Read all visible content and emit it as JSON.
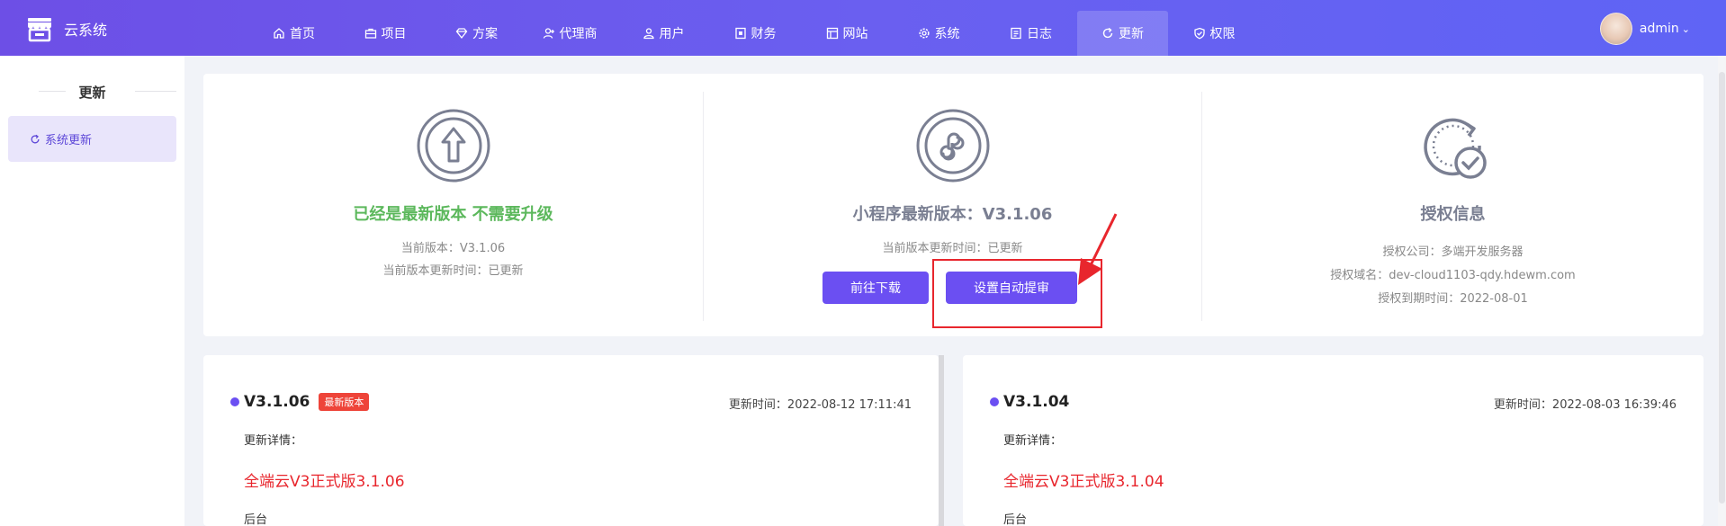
{
  "brand": {
    "name": "云系统"
  },
  "nav": [
    {
      "label": "首页",
      "icon": "home-icon"
    },
    {
      "label": "项目",
      "icon": "briefcase-icon"
    },
    {
      "label": "方案",
      "icon": "diamond-icon"
    },
    {
      "label": "代理商",
      "icon": "user-add-icon"
    },
    {
      "label": "用户",
      "icon": "users-icon"
    },
    {
      "label": "财务",
      "icon": "finance-icon"
    },
    {
      "label": "网站",
      "icon": "website-icon"
    },
    {
      "label": "系统",
      "icon": "gear-icon"
    },
    {
      "label": "日志",
      "icon": "log-icon"
    },
    {
      "label": "更新",
      "icon": "refresh-icon",
      "active": true
    },
    {
      "label": "权限",
      "icon": "shield-check-icon"
    }
  ],
  "user": {
    "name": "admin"
  },
  "sidebar": {
    "title": "更新",
    "items": [
      {
        "label": "系统更新",
        "icon": "refresh-icon",
        "active": true
      }
    ]
  },
  "info": {
    "latest": {
      "title": "已经是最新版本 不需要升级",
      "current_version": "当前版本：V3.1.06",
      "update_time": "当前版本更新时间：已更新"
    },
    "miniprogram": {
      "title": "小程序最新版本：V3.1.06",
      "update_time": "当前版本更新时间：已更新",
      "download_label": "前往下载",
      "auto_audit_label": "设置自动提审"
    },
    "license": {
      "title": "授权信息",
      "company": "授权公司：多端开发服务器",
      "domain": "授权域名：dev-cloud1103-qdy.hdewm.com",
      "expire": "授权到期时间：2022-08-01"
    }
  },
  "versions": [
    {
      "version": "V3.1.06",
      "badge": "最新版本",
      "time": "更新时间：2022-08-12 17:11:41",
      "detail_label": "更新详情：",
      "title": "全端云V3正式版3.1.06",
      "section": "后台"
    },
    {
      "version": "V3.1.04",
      "time": "更新时间：2022-08-03 16:39:46",
      "detail_label": "更新详情：",
      "title": "全端云V3正式版3.1.04",
      "section": "后台"
    }
  ],
  "colors": {
    "accent": "#6b4ff2",
    "success": "#5cb85c",
    "highlight": "#e8262d",
    "badge": "#ee4439"
  }
}
